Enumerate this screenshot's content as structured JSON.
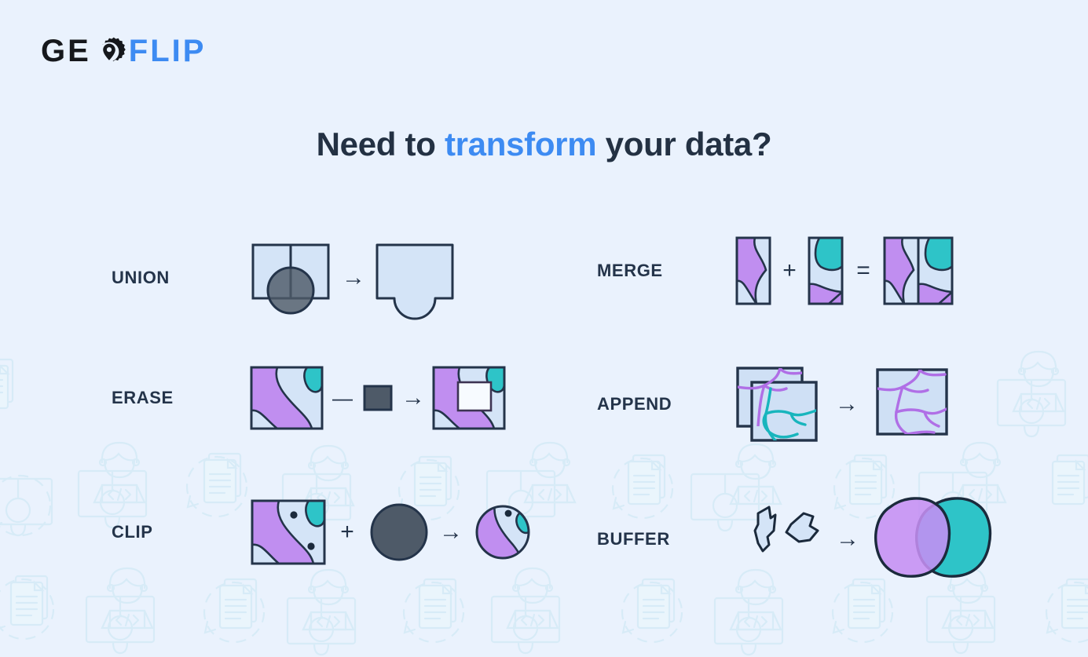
{
  "brand": {
    "name_part1": "GE",
    "name_part2": "FLIP",
    "gear_icon": "gear-location-pin-icon",
    "blue": "#3d8bf2",
    "dark": "#16181c"
  },
  "headline": {
    "before": "Need to ",
    "accent": "transform",
    "after": " your data?"
  },
  "colors": {
    "background": "#eaf2fd",
    "watermark": "#d8ecf7",
    "outline": "#24344a",
    "light_blue": "#d4e4f7",
    "pale_blue": "#cfe0f5",
    "purple": "#c08ef0",
    "teal": "#2ec4c8",
    "slate": "#4e5a68",
    "label": "#24344a",
    "white": "#f7fbff"
  },
  "operations": [
    {
      "id": "union",
      "label": "UNION",
      "column": "left",
      "operator_symbols": [
        "arrow-right"
      ],
      "description": "Two adjacent squares overlapped by a circle combine into one outline with a rounded bulge"
    },
    {
      "id": "merge",
      "label": "MERGE",
      "column": "right",
      "operator_symbols": [
        "plus",
        "equals"
      ],
      "description": "Two map tiles with purple and teal regions combine into a single two-panel tile"
    },
    {
      "id": "erase",
      "label": "ERASE",
      "column": "left",
      "operator_symbols": [
        "minus",
        "arrow-right"
      ],
      "description": "A map tile minus a dark rectangle leaves a rectangular hole in the tile"
    },
    {
      "id": "append",
      "label": "APPEND",
      "column": "right",
      "operator_symbols": [
        "arrow-right"
      ],
      "description": "Two overlapping tiles of purple and teal line networks become one tile of purple lines"
    },
    {
      "id": "clip",
      "label": "CLIP",
      "column": "left",
      "operator_symbols": [
        "plus",
        "arrow-right"
      ],
      "description": "A map tile plus a circle yields a circular cut-out of the map"
    },
    {
      "id": "buffer",
      "label": "BUFFER",
      "column": "right",
      "operator_symbols": [
        "arrow-right"
      ],
      "description": "Two small polygons grow into two large overlapping rounded blobs"
    }
  ],
  "symbols": {
    "arrow_right": "→",
    "plus": "+",
    "minus": "—",
    "equals": "="
  }
}
